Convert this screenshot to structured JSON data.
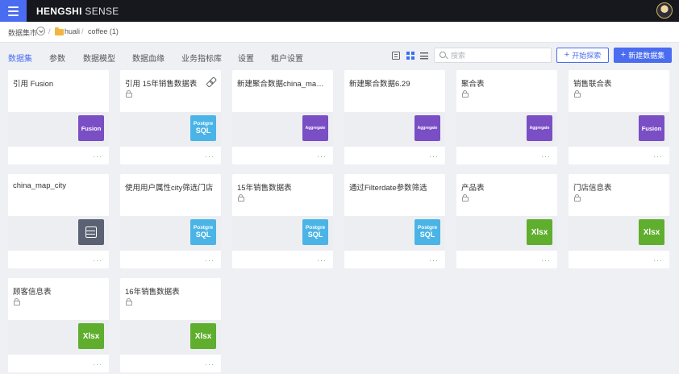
{
  "app": {
    "brand_bold": "HENGSHI",
    "brand_light": " SENSE"
  },
  "breadcrumb": {
    "market": "数据集市",
    "sep": "/",
    "folder": "huali",
    "sep2": "/",
    "current": "coffee (1)"
  },
  "tabs": [
    {
      "label": "数据集",
      "active": true
    },
    {
      "label": "参数"
    },
    {
      "label": "数据模型"
    },
    {
      "label": "数据血缘"
    },
    {
      "label": "业务指标库"
    },
    {
      "label": "设置"
    },
    {
      "label": "租户设置"
    }
  ],
  "search": {
    "placeholder": "搜索"
  },
  "buttons": {
    "explore": "开始探索",
    "new_dataset": "新建数据集",
    "plus": "+"
  },
  "more_label": "···",
  "badge_text": {
    "fusion": "Fusion",
    "postgres_line1": "Postgre",
    "postgres_line2": "SQL",
    "aggregate": "Aggregate",
    "xlsx": "Xlsx"
  },
  "cards": [
    {
      "title": "引用 Fusion",
      "type": "fusion",
      "lock": false,
      "link": false
    },
    {
      "title": "引用 15年销售数据表",
      "type": "postgres",
      "lock": true,
      "link": true
    },
    {
      "title": "新建聚合数据china_map_city",
      "type": "aggregate",
      "lock": false,
      "link": false
    },
    {
      "title": "新建聚合数据6.29",
      "type": "aggregate",
      "lock": false,
      "link": false
    },
    {
      "title": "聚合表",
      "type": "aggregate",
      "lock": true,
      "link": false
    },
    {
      "title": "销售联合表",
      "type": "fusion",
      "lock": true,
      "link": false
    },
    {
      "title": "china_map_city",
      "type": "db",
      "lock": false,
      "link": false
    },
    {
      "title": "使用用户属性city筛选门店",
      "type": "postgres",
      "lock": false,
      "link": false
    },
    {
      "title": "15年销售数据表",
      "type": "postgres",
      "lock": true,
      "link": false
    },
    {
      "title": "通过Filterdate参数筛选",
      "type": "postgres",
      "lock": false,
      "link": false
    },
    {
      "title": "产品表",
      "type": "xlsx",
      "lock": true,
      "link": false
    },
    {
      "title": "门店信息表",
      "type": "xlsx",
      "lock": true,
      "link": false
    },
    {
      "title": "顾客信息表",
      "type": "xlsx",
      "lock": true,
      "link": false
    },
    {
      "title": "16年销售数据表",
      "type": "xlsx",
      "lock": true,
      "link": false
    }
  ],
  "colors": {
    "accent": "#4a6cf0",
    "topbar": "#16181d",
    "fusion": "#7a4ec4",
    "postgres": "#4ab4e6",
    "xlsx": "#5fae2e",
    "db": "#5b6273"
  }
}
